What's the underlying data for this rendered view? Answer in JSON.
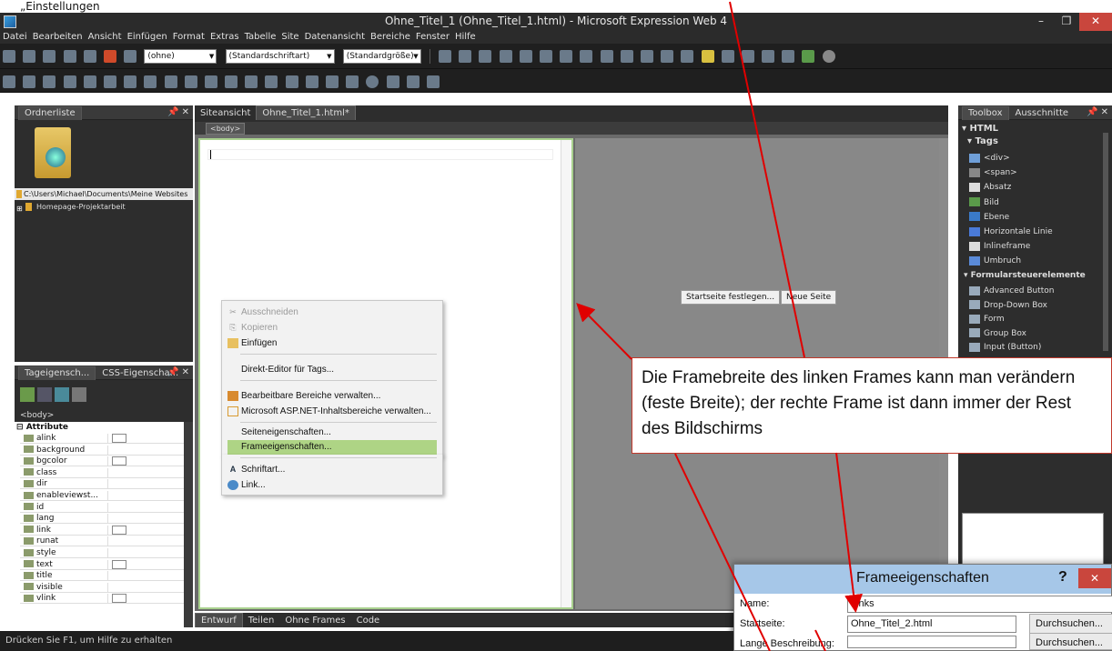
{
  "top_text": "„Einstellungen",
  "window": {
    "title": "Ohne_Titel_1 (Ohne_Titel_1.html) - Microsoft Expression Web 4",
    "minimize": "–",
    "maximize": "❐",
    "close": "✕"
  },
  "menu": [
    "Datei",
    "Bearbeiten",
    "Ansicht",
    "Einfügen",
    "Format",
    "Extras",
    "Tabelle",
    "Site",
    "Datenansicht",
    "Bereiche",
    "Fenster",
    "Hilfe"
  ],
  "toolbar": {
    "style_combo": "(ohne)",
    "font_combo": "(Standardschriftart)",
    "size_combo": "(Standardgröße)"
  },
  "folder_panel": {
    "title": "Ordnerliste",
    "path": "C:\\Users\\Michael\\Documents\\Meine Websites",
    "item": "Homepage-Projektarbeit"
  },
  "doc_tabs": [
    "Siteansicht",
    "Ohne_Titel_1.html*"
  ],
  "breadcrumb_tag": "<body>",
  "frame_buttons": {
    "start": "Startseite festlegen...",
    "new": "Neue Seite"
  },
  "view_tabs": [
    "Entwurf",
    "Teilen",
    "Ohne Frames",
    "Code"
  ],
  "context_menu": [
    {
      "label": "Ausschneiden",
      "disabled": true,
      "icon": "scissors-icon"
    },
    {
      "label": "Kopieren",
      "disabled": true,
      "icon": "copy-icon"
    },
    {
      "label": "Einfügen",
      "disabled": false,
      "icon": "paste-icon"
    },
    {
      "label": "Direkt-Editor für Tags...",
      "disabled": false
    },
    {
      "label": "Bearbeitbare Bereiche verwalten...",
      "disabled": false,
      "icon": "editable-regions-icon"
    },
    {
      "label": "Microsoft ASP.NET-Inhaltsbereiche verwalten...",
      "disabled": false,
      "icon": "aspnet-regions-icon"
    },
    {
      "label": "Seiteneigenschaften...",
      "disabled": false
    },
    {
      "label": "Frameeigenschaften...",
      "disabled": false,
      "highlight": true
    },
    {
      "label": "Schriftart...",
      "disabled": false,
      "icon": "font-icon"
    },
    {
      "label": "Link...",
      "disabled": false,
      "icon": "link-icon"
    }
  ],
  "props_panel": {
    "tabs": [
      "Tageigensch...",
      "CSS-Eigenscha..."
    ],
    "tag": "<body>",
    "section": "Attribute",
    "rows": [
      "alink",
      "background",
      "bgcolor",
      "class",
      "dir",
      "enableviewst...",
      "id",
      "lang",
      "link",
      "runat",
      "style",
      "text",
      "title",
      "visible",
      "vlink"
    ],
    "swatch_rows": [
      "alink",
      "bgcolor",
      "link",
      "text",
      "vlink"
    ]
  },
  "toolbox": {
    "tabs": [
      "Toolbox",
      "Ausschnitte"
    ],
    "html": "HTML",
    "tags_head": "Tags",
    "tags": [
      "<div>",
      "<span>",
      "Absatz",
      "Bild",
      "Ebene",
      "Horizontale Linie",
      "Inlineframe",
      "Umbruch"
    ],
    "form_head": "Formularsteuerelemente",
    "forms": [
      "Advanced Button",
      "Drop-Down Box",
      "Form",
      "Group Box",
      "Input (Button)"
    ]
  },
  "callout": "Die Framebreite des linken Frames kann man verändern (feste Breite); der rechte Frame ist dann immer der Rest des Bildschirms",
  "dialog": {
    "title": "Frameeigenschaften",
    "help": "?",
    "close": "✕",
    "fields": [
      {
        "label": "Name:",
        "value": "Links"
      },
      {
        "label": "Startseite:",
        "value": "Ohne_Titel_2.html",
        "button": "Durchsuchen..."
      },
      {
        "label": "Lange Beschreibung:",
        "value": "",
        "button": "Durchsuchen..."
      }
    ]
  },
  "status": "Drücken Sie F1, um Hilfe zu erhalten",
  "colors": {
    "accent_green": "#aed485",
    "arrow_red": "#e00000",
    "dialog_title": "#a6c7e8"
  }
}
